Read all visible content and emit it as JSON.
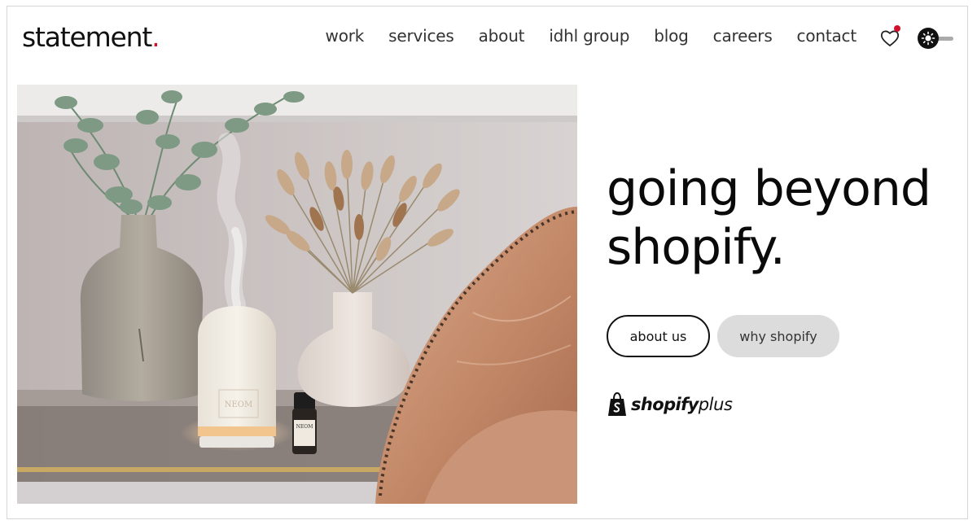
{
  "brand": {
    "name": "statement",
    "dot": ".",
    "accent_color": "#d0112b"
  },
  "nav": {
    "items": [
      {
        "label": "work"
      },
      {
        "label": "services"
      },
      {
        "label": "about"
      },
      {
        "label": "idhl group"
      },
      {
        "label": "blog"
      },
      {
        "label": "careers"
      },
      {
        "label": "contact"
      }
    ],
    "wishlist_icon": "heart-icon",
    "theme_icon": "sun-icon"
  },
  "hero": {
    "headline_line1": "going beyond",
    "headline_line2": "shopify.",
    "buttons": {
      "about_label": "about us",
      "why_label": "why shopify"
    },
    "partner_logo": {
      "icon": "shopify-bag-icon",
      "word1": "shopify",
      "word2": "plus"
    },
    "image_alt": "NEOM diffuser, essential oil bottle and dried bunny tails in vase on glass table beside leather chair",
    "image_text": {
      "diffuser_brand": "NEOM",
      "bottle_brand": "NEOM"
    }
  }
}
